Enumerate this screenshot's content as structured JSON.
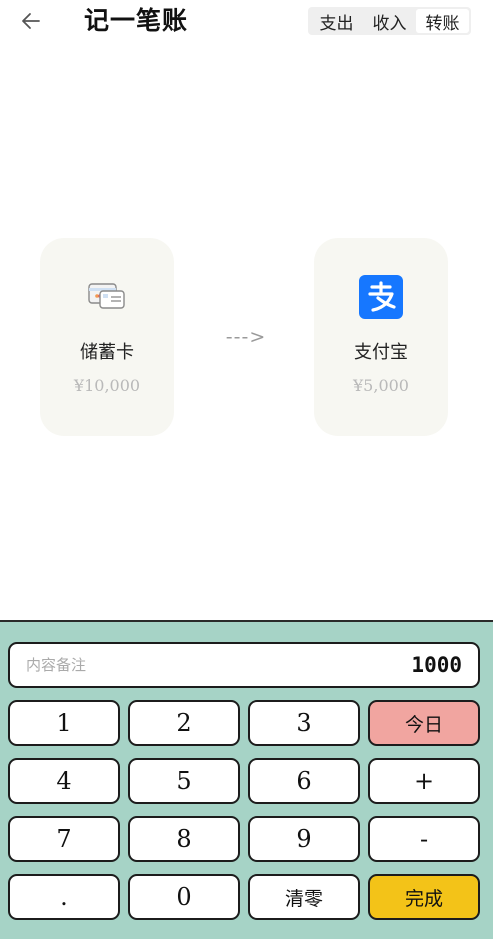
{
  "header": {
    "back_icon": "arrow-left-icon",
    "title": "记一笔账",
    "segments": [
      {
        "label": "支出",
        "active": false
      },
      {
        "label": "收入",
        "active": false
      },
      {
        "label": "转账",
        "active": true
      }
    ]
  },
  "transfer": {
    "from": {
      "name": "储蓄卡",
      "balance": "¥10,000",
      "icon": "bank-card-icon"
    },
    "arrow": "--->",
    "to": {
      "name": "支付宝",
      "balance": "¥5,000",
      "icon": "alipay-icon"
    }
  },
  "keyboard": {
    "memo_placeholder": "内容备注",
    "amount": "1000",
    "keys": {
      "k1": "1",
      "k2": "2",
      "k3": "3",
      "today": "今日",
      "k4": "4",
      "k5": "5",
      "k6": "6",
      "plus": "+",
      "k7": "7",
      "k8": "8",
      "k9": "9",
      "minus": "-",
      "dot": ".",
      "k0": "0",
      "clear": "清零",
      "done": "完成"
    }
  },
  "colors": {
    "keyboard_bg": "#a6d3c6",
    "today_key": "#f1a5a0",
    "done_key": "#f3c318",
    "alipay_blue": "#1677ff",
    "card_bg": "#f7f7f2"
  }
}
